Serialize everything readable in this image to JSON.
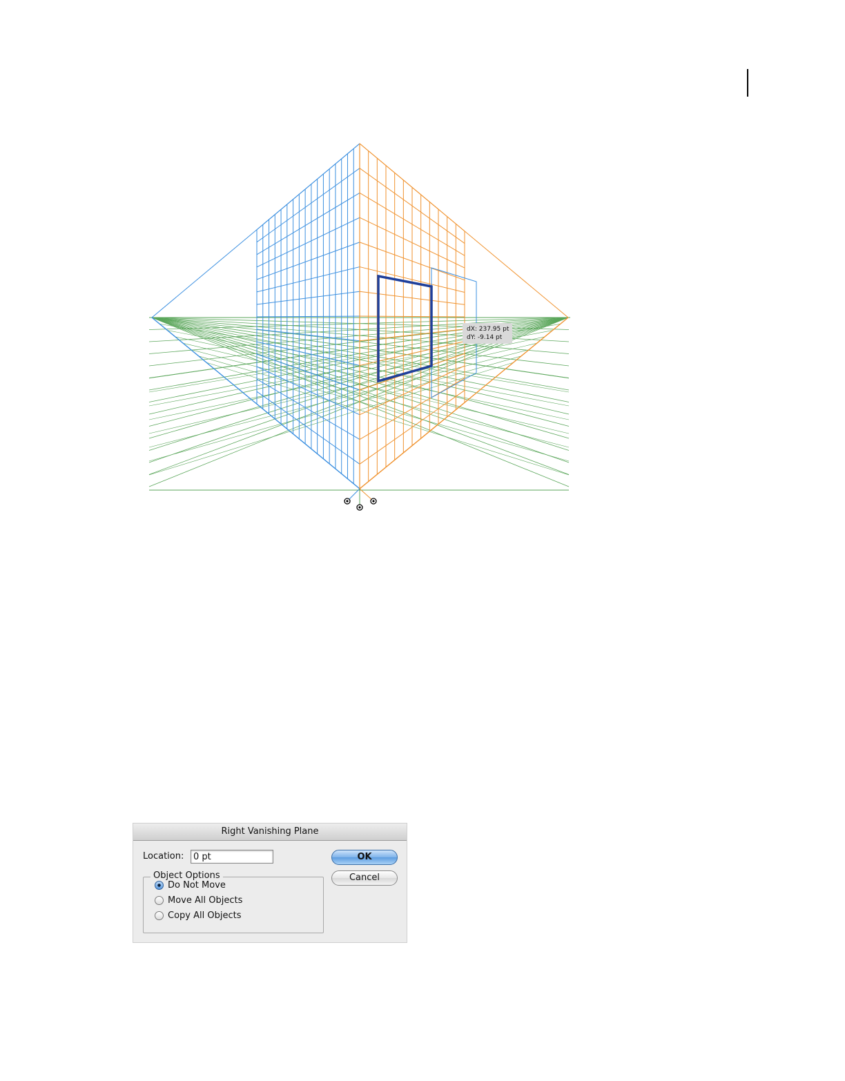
{
  "figure": {
    "colors": {
      "left_plane": "#3b8fe0",
      "right_plane": "#f0922e",
      "ground_plane": "#5aa65a",
      "selection": "#1f3f9a"
    },
    "tooltip": {
      "dx": "dX: 237.95 pt",
      "dy": "dY: -9.14 pt"
    }
  },
  "dialog": {
    "title": "Right Vanishing Plane",
    "location_label": "Location:",
    "location_value": "0 pt",
    "ok_label": "OK",
    "cancel_label": "Cancel",
    "object_options": {
      "legend": "Object Options",
      "options": [
        {
          "label": "Do Not Move",
          "selected": true
        },
        {
          "label": "Move All Objects",
          "selected": false
        },
        {
          "label": "Copy All Objects",
          "selected": false
        }
      ]
    }
  }
}
